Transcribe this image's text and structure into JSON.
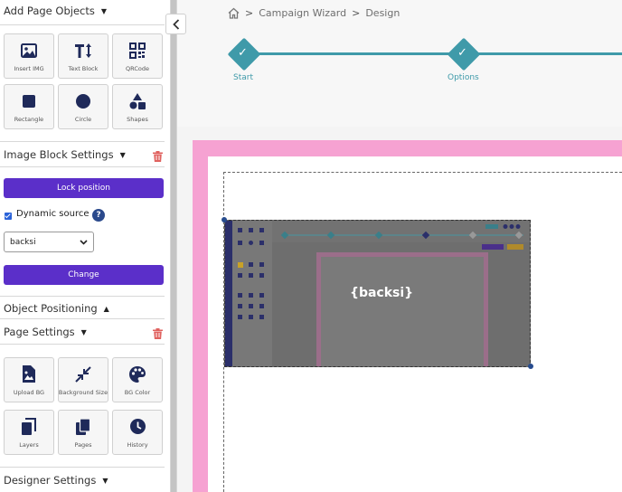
{
  "sidebar": {
    "add_objects_title": "Add Page Objects",
    "objects": [
      {
        "label": "Insert IMG",
        "icon": "image-icon"
      },
      {
        "label": "Text Block",
        "icon": "text-height-icon"
      },
      {
        "label": "QRCode",
        "icon": "qrcode-icon"
      },
      {
        "label": "Rectangle",
        "icon": "square-icon"
      },
      {
        "label": "Circle",
        "icon": "circle-icon"
      },
      {
        "label": "Shapes",
        "icon": "shapes-icon"
      }
    ],
    "image_block_title": "Image Block Settings",
    "lock_position": "Lock position",
    "dynamic_source_label": "Dynamic source",
    "dynamic_source_checked": true,
    "source_select_value": "backsi",
    "change_button": "Change",
    "object_positioning_title": "Object Positioning",
    "page_settings_title": "Page Settings",
    "page_tools": [
      {
        "label": "Upload BG",
        "icon": "upload-image-icon"
      },
      {
        "label": "Background Size",
        "icon": "compress-arrows-icon"
      },
      {
        "label": "BG Color",
        "icon": "palette-icon"
      },
      {
        "label": "Layers",
        "icon": "layers-icon"
      },
      {
        "label": "Pages",
        "icon": "pages-icon"
      },
      {
        "label": "History",
        "icon": "clock-icon"
      }
    ],
    "designer_settings_title": "Designer Settings"
  },
  "breadcrumb": {
    "items": [
      "Campaign Wizard",
      "Design"
    ],
    "separator": ">"
  },
  "wizard": {
    "steps": [
      "Start",
      "Options"
    ],
    "color": "#3f9aa9"
  },
  "canvas": {
    "image_placeholder_text": "{backsi}",
    "frame_color": "#f6a2d2"
  },
  "colors": {
    "accent": "#5b2fc9",
    "icon": "#1f2a5a",
    "delete": "#e0625f"
  }
}
